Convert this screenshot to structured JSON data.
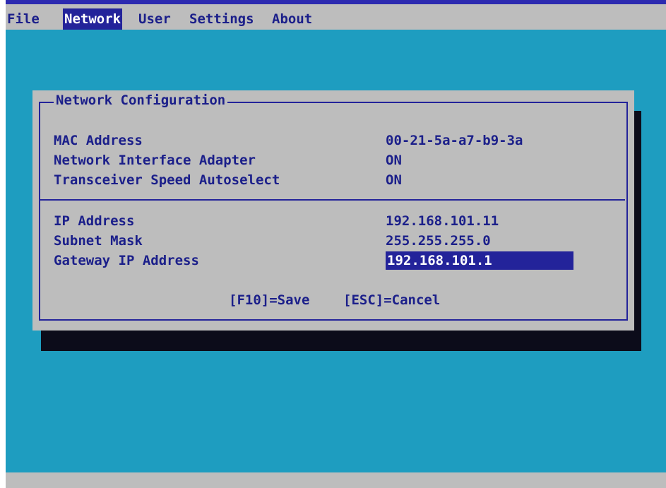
{
  "menu": {
    "items": [
      {
        "label": "File"
      },
      {
        "label": "Network"
      },
      {
        "label": "User"
      },
      {
        "label": "Settings"
      },
      {
        "label": "About"
      }
    ],
    "active": "Network"
  },
  "dialog": {
    "title": "Network Configuration",
    "section1": [
      {
        "label": "MAC Address",
        "value": "00-21-5a-a7-b9-3a"
      },
      {
        "label": "Network Interface Adapter",
        "value": "ON"
      },
      {
        "label": "Transceiver Speed Autoselect",
        "value": "ON"
      }
    ],
    "section2": [
      {
        "label": "IP Address",
        "value": "192.168.101.11"
      },
      {
        "label": "Subnet Mask",
        "value": "255.255.255.0"
      },
      {
        "label": "Gateway IP Address",
        "value": "192.168.101.1",
        "selected": true
      }
    ],
    "save_hint": "[F10]=Save",
    "cancel_hint": "[ESC]=Cancel"
  },
  "colors": {
    "background": "#1e9dc0",
    "panel": "#bdbdbd",
    "text": "#1b1f8a",
    "highlight": "#23239a",
    "highlight_text": "#ffffff",
    "shadow": "#0c0c1a"
  }
}
